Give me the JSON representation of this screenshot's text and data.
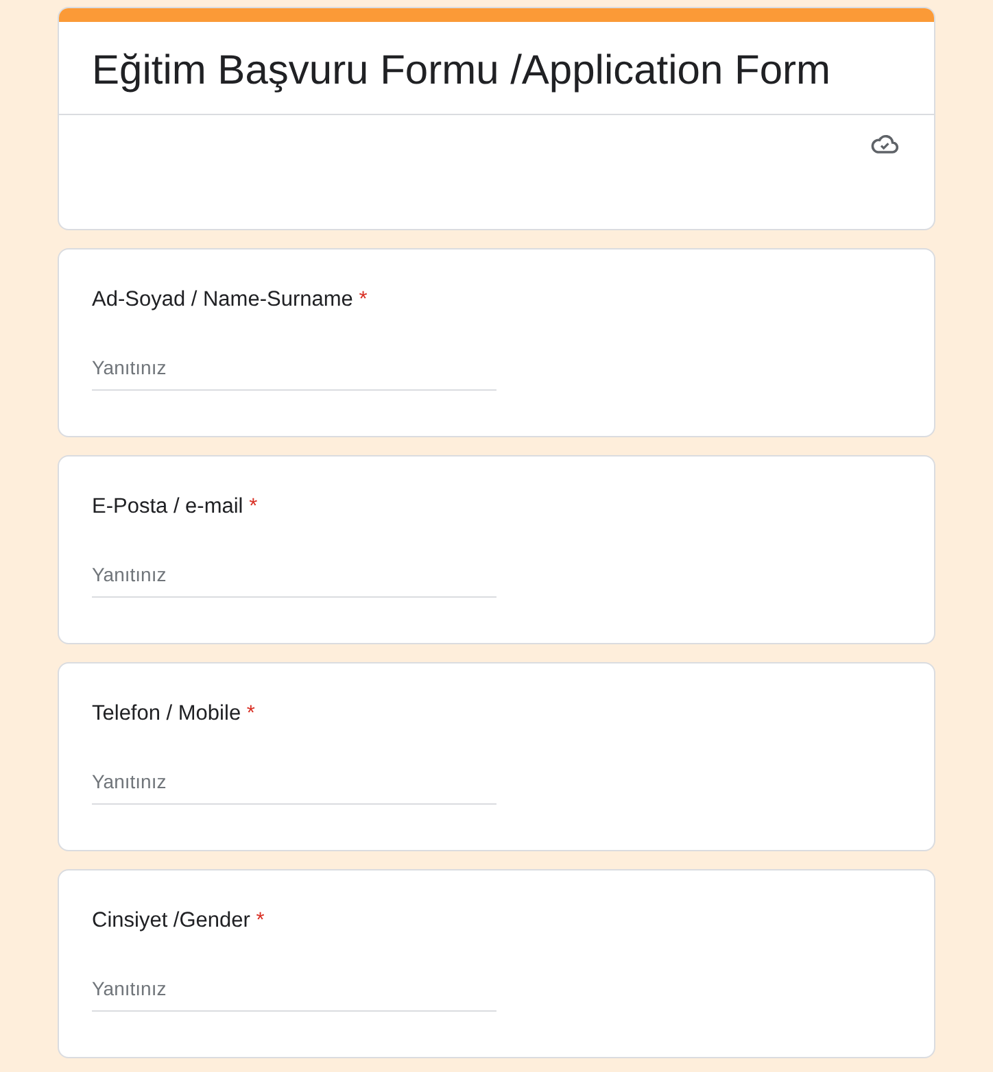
{
  "form": {
    "title": "Eğitim Başvuru Formu /Application Form"
  },
  "questions": [
    {
      "label": "Ad-Soyad / Name-Surname",
      "required_mark": "*",
      "placeholder": "Yanıtınız"
    },
    {
      "label": "E-Posta / e-mail",
      "required_mark": "*",
      "placeholder": "Yanıtınız"
    },
    {
      "label": "Telefon / Mobile",
      "required_mark": "*",
      "placeholder": "Yanıtınız"
    },
    {
      "label": "Cinsiyet /Gender",
      "required_mark": "*",
      "placeholder": "Yanıtınız"
    }
  ]
}
